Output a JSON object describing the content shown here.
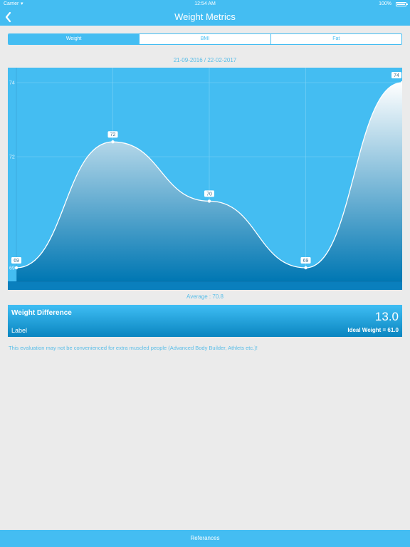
{
  "status_bar": {
    "carrier": "Carrier",
    "time": "12:54 AM",
    "battery": "100%"
  },
  "nav": {
    "title": "Weight Metrics",
    "back_icon": "chevron-left-icon"
  },
  "segments": [
    {
      "label": "Weight",
      "active": true
    },
    {
      "label": "BMI",
      "active": false
    },
    {
      "label": "Fat",
      "active": false
    }
  ],
  "date_range": "21-09-2016 / 22-02-2017",
  "chart_data": {
    "type": "area",
    "x": [
      0,
      1,
      2,
      3,
      4
    ],
    "y_tick_labels": [
      "74",
      "72",
      "69"
    ],
    "series": [
      {
        "values": [
          69,
          72.4,
          70.8,
          69,
          74
        ],
        "point_labels": [
          "69",
          "72",
          "70",
          "69",
          "74"
        ]
      }
    ],
    "ylim": [
      68.9,
      74.2
    ],
    "grid": true,
    "colors": {
      "background": "#44bdf2",
      "fill_top": "#ffffff",
      "fill_bottom": "#0077b3",
      "line": "#ffffff"
    }
  },
  "average": "Average : 70.8",
  "weight_difference": {
    "title": "Weight Difference",
    "value": "13.0",
    "label": "Label",
    "ideal": "Ideal Weight = 61.0"
  },
  "disclaimer": "This evaluation may not be convenienced for extra muscled people (Advanced Body Builder, Athlets etc.)!",
  "footer": {
    "label": "Referances"
  }
}
